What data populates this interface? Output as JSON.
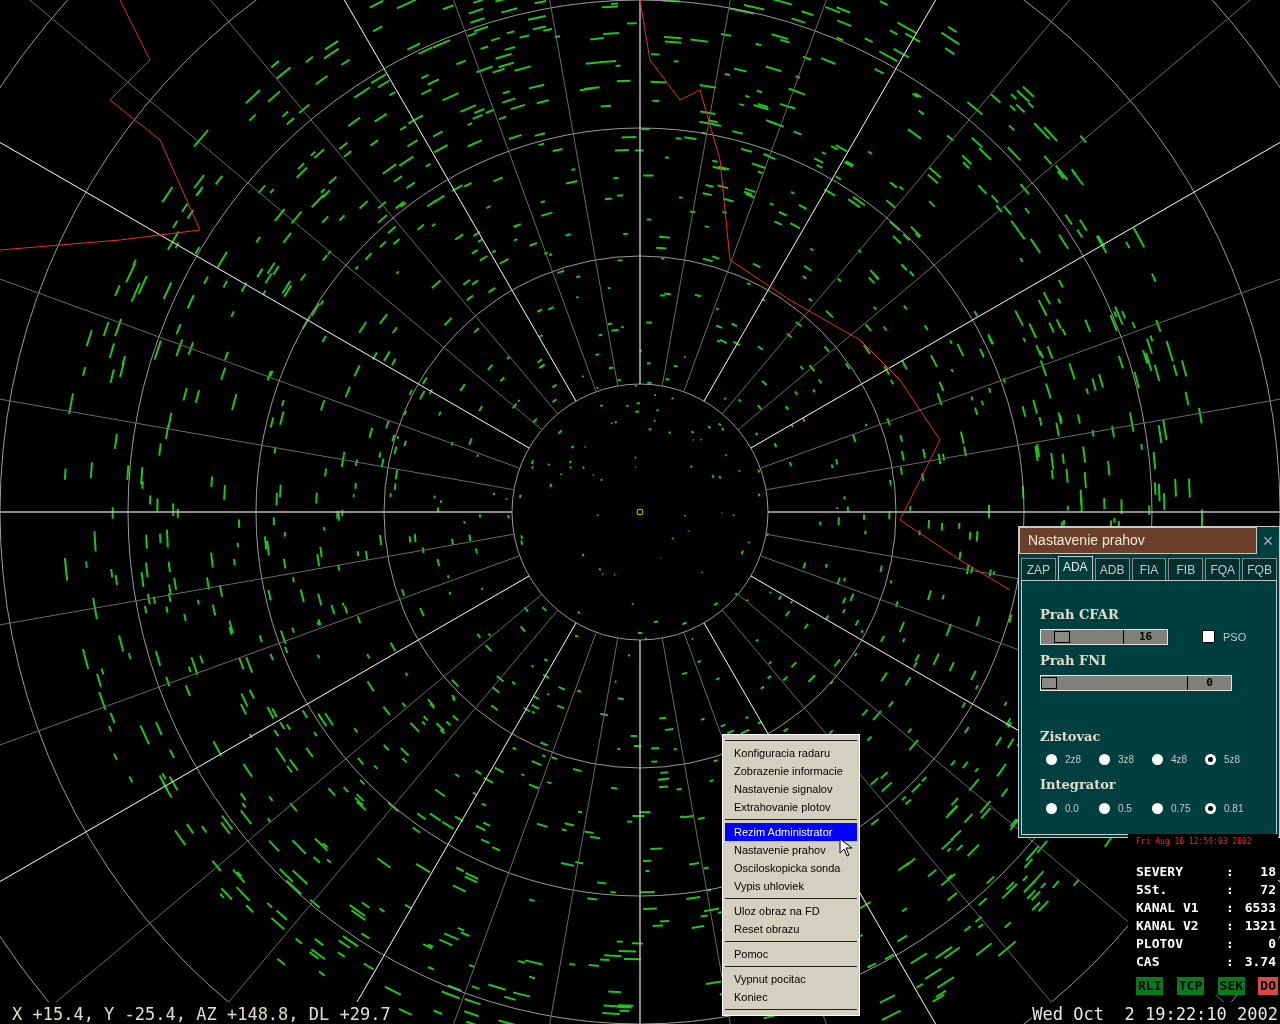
{
  "radar": {
    "coordinates": "X +15.4, Y -25.4, AZ +148.8, DL +29.7",
    "clock": "Wed Oct  2 19:22:10 2002"
  },
  "dialog": {
    "title": "Nastavenie prahov",
    "close": "×",
    "tabs": [
      {
        "label": "ZAP",
        "selected": false
      },
      {
        "label": "ADA",
        "selected": true
      },
      {
        "label": "ADB",
        "selected": false
      },
      {
        "label": "FIA",
        "selected": false
      },
      {
        "label": "FIB",
        "selected": false
      },
      {
        "label": "FQA",
        "selected": false
      },
      {
        "label": "FQB",
        "selected": false
      }
    ],
    "sliders": [
      {
        "label": "Prah CFAR",
        "value": "16",
        "level": 0.2
      },
      {
        "label": "Prah FNI",
        "value": "0",
        "level": 0.0
      }
    ],
    "checkbox": {
      "label": "PSO",
      "checked": false
    },
    "radio_groups": [
      {
        "label": "Zistovac",
        "options": [
          {
            "label": "2z8",
            "selected": false
          },
          {
            "label": "3z8",
            "selected": false
          },
          {
            "label": "4z8",
            "selected": false
          },
          {
            "label": "5z8",
            "selected": true
          }
        ]
      },
      {
        "label": "Integrator",
        "options": [
          {
            "label": "0.0",
            "selected": false
          },
          {
            "label": "0.5",
            "selected": false
          },
          {
            "label": "0.75",
            "selected": false
          },
          {
            "label": "0.81",
            "selected": true
          }
        ]
      }
    ]
  },
  "context_menu": {
    "groups": [
      [
        {
          "label": "Konfiguracia radaru",
          "selected": false
        },
        {
          "label": "Zobrazenie informacie",
          "selected": false
        },
        {
          "label": "Nastavenie signalov",
          "selected": false
        },
        {
          "label": "Extrahovanie plotov",
          "selected": false
        }
      ],
      [
        {
          "label": "Rezim Administrator",
          "selected": true
        },
        {
          "label": "Nastavenie prahov",
          "selected": false
        },
        {
          "label": "Osciloskopicka sonda",
          "selected": false
        },
        {
          "label": "Vypis uhloviek",
          "selected": false
        }
      ],
      [
        {
          "label": "Uloz obraz na FD",
          "selected": false
        },
        {
          "label": "Reset obrazu",
          "selected": false
        }
      ],
      [
        {
          "label": "Pomoc",
          "selected": false
        }
      ],
      [
        {
          "label": "Vypnut pocitac",
          "selected": false
        },
        {
          "label": "Koniec",
          "selected": false
        }
      ]
    ]
  },
  "status_panel": {
    "timestamp": "Fri Aug 16 12:59:03 2002",
    "rows": [
      {
        "name": "SEVERY",
        "separator": ":",
        "value": "18"
      },
      {
        "name": "5St.",
        "separator": ":",
        "value": "72"
      },
      {
        "name": "KANAL V1",
        "separator": ":",
        "value": "6533"
      },
      {
        "name": "KANAL V2",
        "separator": ":",
        "value": "1321"
      },
      {
        "name": "PLOTOV",
        "separator": ":",
        "value": "0"
      },
      {
        "name": "CAS",
        "separator": ":",
        "value": "3.74"
      }
    ],
    "indicators": [
      {
        "label": "RLI",
        "color": "#0b7a1e"
      },
      {
        "label": "TCP",
        "color": "#0b7a1e"
      },
      {
        "label": "SEK",
        "color": "#0b7a1e"
      },
      {
        "label": "DO",
        "color": "#d24a4a"
      }
    ]
  }
}
